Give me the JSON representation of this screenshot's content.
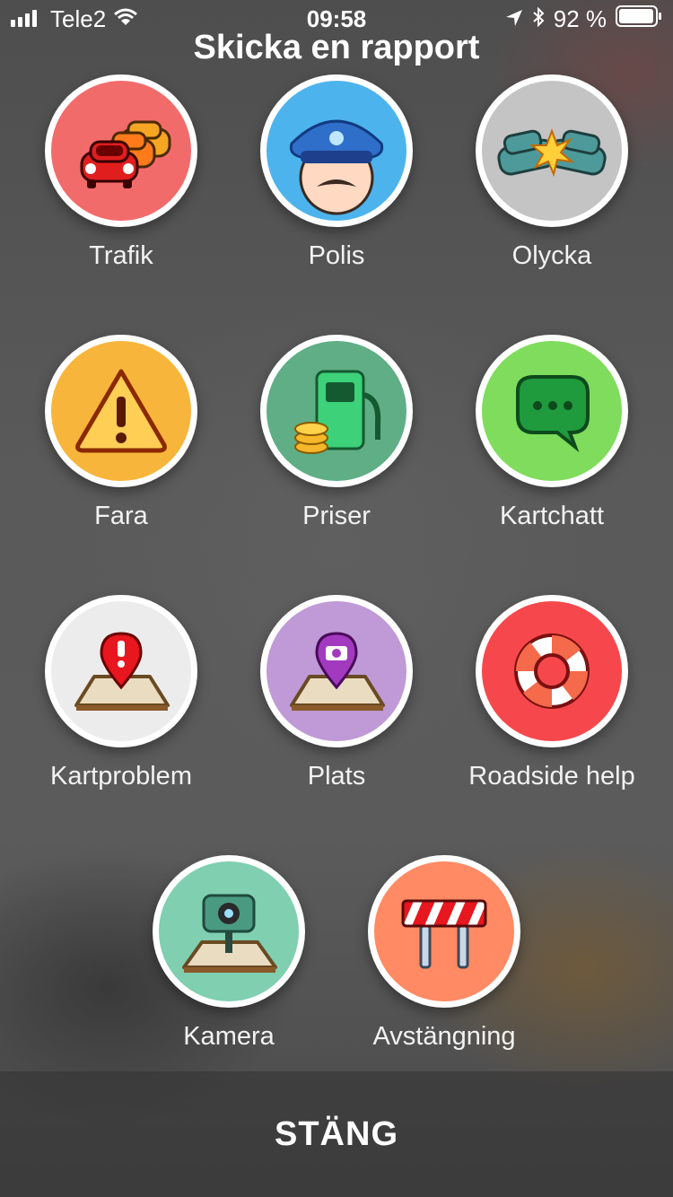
{
  "status": {
    "carrier": "Tele2",
    "time": "09:58",
    "battery": "92 %"
  },
  "title": "Skicka en rapport",
  "reports": [
    {
      "label": "Trafik",
      "color": "#f26b6b"
    },
    {
      "label": "Polis",
      "color": "#4db3ec"
    },
    {
      "label": "Olycka",
      "color": "#c4c4c4"
    },
    {
      "label": "Fara",
      "color": "#f8b53b"
    },
    {
      "label": "Priser",
      "color": "#5fae86"
    },
    {
      "label": "Kartchatt",
      "color": "#7fdc5c"
    },
    {
      "label": "Kartproblem",
      "color": "#ececec"
    },
    {
      "label": "Plats",
      "color": "#bf9ad6"
    },
    {
      "label": "Roadside help",
      "color": "#f6484c"
    },
    {
      "label": "Kamera",
      "color": "#7fcfb0"
    },
    {
      "label": "Avstängning",
      "color": "#ff8a64"
    }
  ],
  "close_label": "STÄNG"
}
